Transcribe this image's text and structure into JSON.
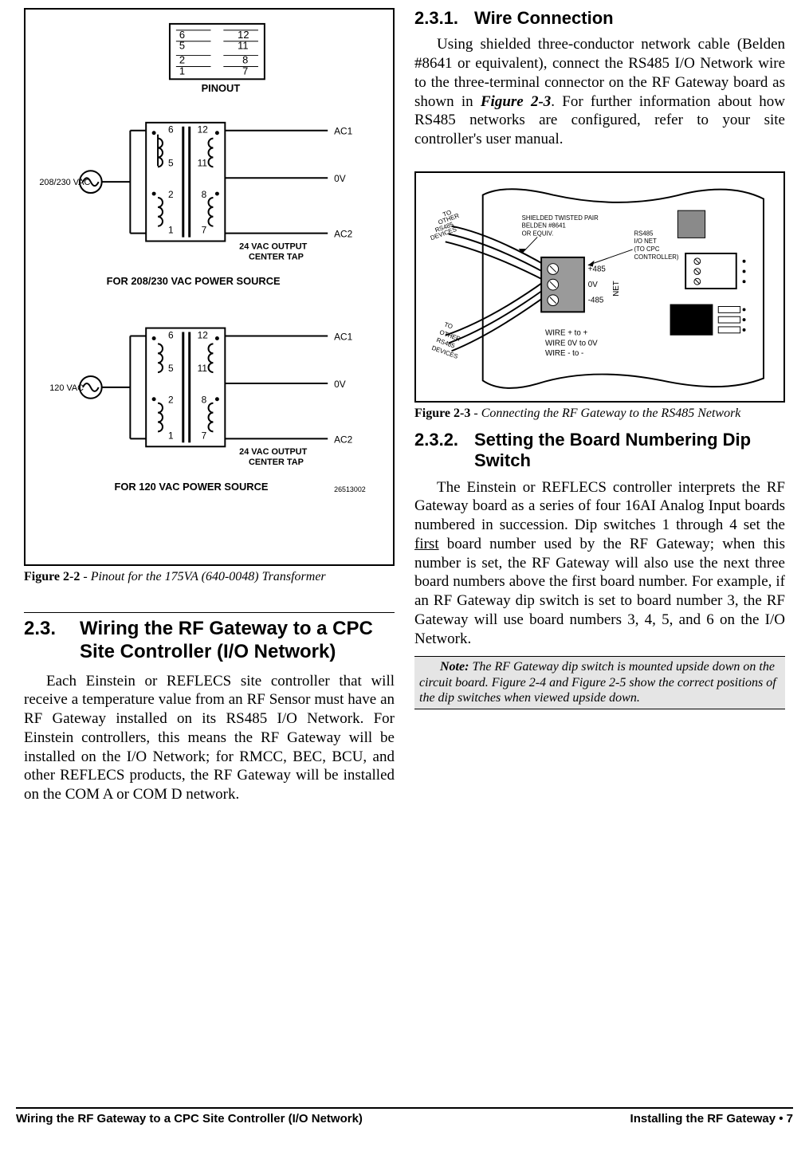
{
  "left": {
    "figure2_2": {
      "label": "Figure 2-2",
      "sep": " - ",
      "title": "Pinout for the 175VA (640-0048) Transformer",
      "diagram": {
        "pinout_label": "PINOUT",
        "pins_left": [
          "6",
          "5",
          "2",
          "1"
        ],
        "pins_right": [
          "12",
          "11",
          "8",
          "7"
        ],
        "src_208_label": "208/230 VAC",
        "src_120_label": "120 VAC",
        "out_ac1": "AC1",
        "out_0v": "0V",
        "out_ac2": "AC2",
        "center_tap": "24 VAC OUTPUT\nCENTER TAP",
        "heading_208": "FOR 208/230 VAC POWER SOURCE",
        "heading_120": "FOR 120 VAC POWER SOURCE",
        "partnum": "26513002",
        "left_pin_nums": [
          "6",
          "5",
          "2",
          "1"
        ],
        "right_pin_nums": [
          "12",
          "11",
          "8",
          "7"
        ]
      }
    },
    "section_2_3": {
      "num": "2.3.",
      "title": "Wiring the RF Gateway to a CPC Site Controller (I/O Network)",
      "para": "Each Einstein or REFLECS site controller that will receive a temperature value from an RF Sensor must have an RF Gateway installed on its RS485 I/O Network. For Einstein controllers, this means the RF Gateway will be installed on the I/O Network; for RMCC, BEC, BCU, and other REFLECS products, the RF Gateway will be installed on the COM A or COM D network."
    }
  },
  "right": {
    "sub_2_3_1": {
      "num": "2.3.1.",
      "title": "Wire Connection",
      "para_pre": "Using shielded three-conductor network cable (Belden #8641 or equivalent), connect the RS485 I/O Network wire to the three-terminal connector on the RF Gateway board as shown in ",
      "figref": "Figure 2-3",
      "para_post": ". For further information about how RS485 networks are configured, refer to your site controller's user manual."
    },
    "figure2_3": {
      "label": "Figure 2-3",
      "sep": " - ",
      "title": "Connecting the RF Gateway to the RS485 Network",
      "diagram": {
        "shielded": "SHIELDED TWISTED PAIR\nBELDEN #8641\nOR EQUIV.",
        "to_other_up": "TO\nOTHER\nRS485\nDEVICES",
        "to_other_down": "TO\nOTHER\nRS485\nDEVICES",
        "rs485_io": "RS485\nI/O NET\n(TO CPC\nCONTROLLER)",
        "plus": "+485",
        "zero": "0V",
        "minus": "-485",
        "net": "NET",
        "wire_legend": "WIRE + to +\nWIRE 0V to 0V\nWIRE - to -"
      }
    },
    "sub_2_3_2": {
      "num": "2.3.2.",
      "title": "Setting the Board Number­ing Dip Switch",
      "para_pre": "The Einstein or REFLECS controller inter­prets the RF Gateway board as a series of four 16AI Analog Input boards numbered in succes­sion. Dip switches 1 through 4 set the ",
      "first": "first",
      "para_post": " board number used by the RF Gateway; when this number is set, the RF Gateway will also use the next three board numbers above the first board number. For example, if an RF Gateway dip switch is set to board number 3, the RF Gateway will use board numbers 3, 4, 5, and 6 on the I/O Network."
    },
    "note": {
      "label": "Note:",
      "text": " The RF Gateway dip switch is mounted upside down on the circuit board. Figure 2-4 and Figure 2-5 show the correct positions of the dip switches when viewed upside down."
    }
  },
  "footer": {
    "left": "Wiring the RF Gateway to a CPC Site Controller (I/O Network)",
    "right": "Installing the RF Gateway • 7"
  }
}
